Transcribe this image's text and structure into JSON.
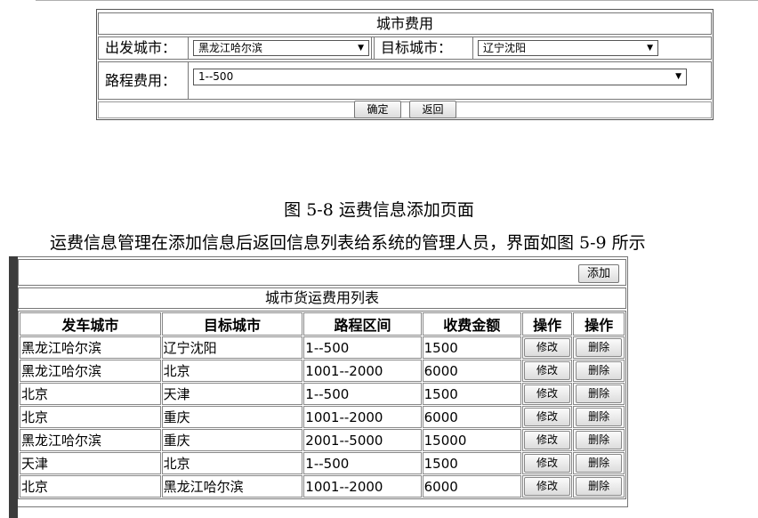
{
  "form": {
    "title": "城市费用",
    "depart_label": "出发城市：",
    "depart_value": "黑龙江哈尔滨",
    "target_label": "目标城市：",
    "target_value": "辽宁沈阳",
    "cost_label": "路程费用：",
    "cost_value": "1--500",
    "confirm_label": "确定",
    "back_label": "返回"
  },
  "caption": "图 5-8 运费信息添加页面",
  "paragraph": "运费信息管理在添加信息后返回信息列表给系统的管理人员，界面如图 5-9 所示",
  "list": {
    "add_label": "添加",
    "title": "城市货运费用列表",
    "headers": [
      "发车城市",
      "目标城市",
      "路程区间",
      "收费金额",
      "操作",
      "操作"
    ],
    "edit_label": "修改",
    "delete_label": "删除",
    "rows": [
      [
        "黑龙江哈尔滨",
        "辽宁沈阳",
        "1--500",
        "1500"
      ],
      [
        "黑龙江哈尔滨",
        "北京",
        "1001--2000",
        "6000"
      ],
      [
        "北京",
        "天津",
        "1--500",
        "1500"
      ],
      [
        "北京",
        "重庆",
        "1001--2000",
        "6000"
      ],
      [
        "黑龙江哈尔滨",
        "重庆",
        "2001--5000",
        "15000"
      ],
      [
        "天津",
        "北京",
        "1--500",
        "1500"
      ],
      [
        "北京",
        "黑龙江哈尔滨",
        "1001--2000",
        "6000"
      ]
    ]
  }
}
